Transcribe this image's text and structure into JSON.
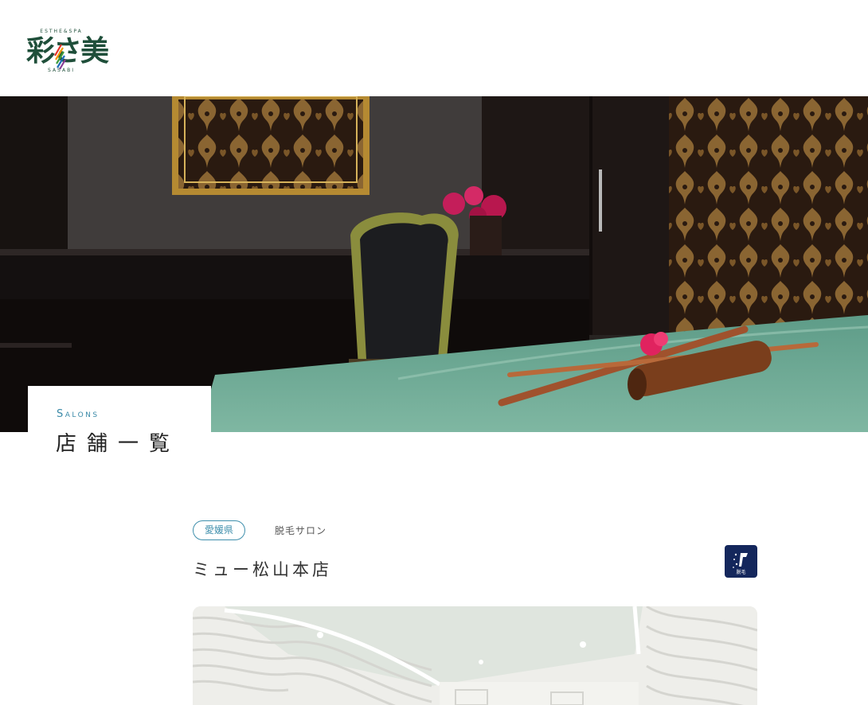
{
  "header": {
    "logo_text": "彩さ美",
    "logo_top": "ESTHE&SPA",
    "logo_bottom": "SASABI"
  },
  "page_title": {
    "en": "Salons",
    "ja": "店舗一覧"
  },
  "salon": {
    "prefecture": "愛媛県",
    "category": "脱毛サロン",
    "name": "ミュー松山本店",
    "service_icon": "hair-removal-icon",
    "service_icon_label": "脱毛"
  },
  "colors": {
    "brand_green": "#1f4f3a",
    "accent_blue": "#3f8fac",
    "badge_navy": "#14275c"
  }
}
